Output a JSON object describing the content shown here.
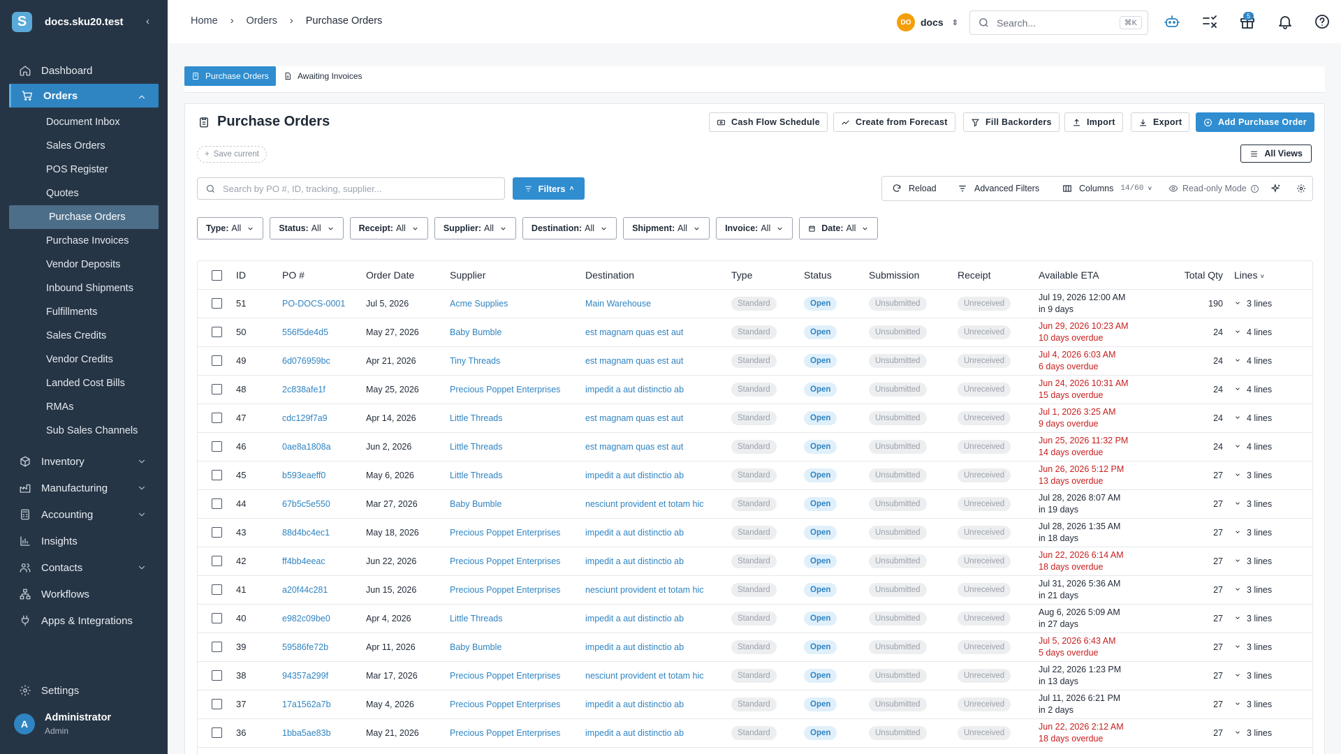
{
  "app": {
    "domain": "docs.sku20.test",
    "logo_letter": "S"
  },
  "sidebar": {
    "items": [
      {
        "label": "Dashboard",
        "icon": "home-icon"
      },
      {
        "label": "Orders",
        "icon": "cart-icon",
        "expanded": true
      },
      {
        "label": "Inventory",
        "icon": "box-icon"
      },
      {
        "label": "Manufacturing",
        "icon": "factory-icon"
      },
      {
        "label": "Accounting",
        "icon": "calculator-icon"
      },
      {
        "label": "Insights",
        "icon": "chart-icon"
      },
      {
        "label": "Contacts",
        "icon": "contacts-icon"
      },
      {
        "label": "Workflows",
        "icon": "workflow-icon"
      },
      {
        "label": "Apps & Integrations",
        "icon": "plug-icon"
      }
    ],
    "orders_sub": [
      "Document Inbox",
      "Sales Orders",
      "POS Register",
      "Quotes",
      "Purchase Orders",
      "Purchase Invoices",
      "Vendor Deposits",
      "Inbound Shipments",
      "Fulfillments",
      "Sales Credits",
      "Vendor Credits",
      "Landed Cost Bills",
      "RMAs",
      "Sub Sales Channels"
    ],
    "settings": "Settings",
    "user": {
      "initial": "A",
      "name": "Administrator",
      "role": "Admin"
    }
  },
  "topbar": {
    "breadcrumb": [
      "Home",
      "Orders",
      "Purchase Orders"
    ],
    "workspace": {
      "initials": "DO",
      "name": "docs"
    },
    "search": {
      "placeholder": "Search...",
      "shortcut": "⌘K"
    },
    "notification_badge": "5"
  },
  "tabs": [
    "Purchase Orders",
    "Awaiting Invoices"
  ],
  "page": {
    "title": "Purchase Orders",
    "actions": [
      "Cash Flow Schedule",
      "Create from Forecast",
      "Fill Backorders",
      "Import",
      "Export",
      "Add Purchase Order"
    ],
    "save_current": "Save current",
    "all_views": "All Views",
    "search_placeholder": "Search by PO #, ID, tracking, supplier...",
    "filters_label": "Filters",
    "toolbar": {
      "reload": "Reload",
      "advanced": "Advanced Filters",
      "columns": "Columns",
      "columns_count": "14/60",
      "readonly": "Read-only Mode"
    },
    "filter_chips": [
      {
        "key": "Type:",
        "value": "All"
      },
      {
        "key": "Status:",
        "value": "All"
      },
      {
        "key": "Receipt:",
        "value": "All"
      },
      {
        "key": "Supplier:",
        "value": "All"
      },
      {
        "key": "Destination:",
        "value": "All"
      },
      {
        "key": "Shipment:",
        "value": "All"
      },
      {
        "key": "Invoice:",
        "value": "All"
      },
      {
        "key": "Date:",
        "value": "All"
      }
    ]
  },
  "table": {
    "columns": [
      "ID",
      "PO #",
      "Order Date",
      "Supplier",
      "Destination",
      "Type",
      "Status",
      "Submission",
      "Receipt",
      "Available ETA",
      "Total Qty",
      "Lines"
    ],
    "rows": [
      {
        "id": "51",
        "po": "PO-DOCS-0001",
        "date": "Jul 5, 2026",
        "supplier": "Acme Supplies",
        "dest": "Main Warehouse",
        "type": "Standard",
        "status": "Open",
        "sub": "Unsubmitted",
        "receipt": "Unreceived",
        "eta": "Jul 19, 2026 12:00 AM",
        "eta_note": "in 9 days",
        "overdue": false,
        "qty": "190",
        "lines": "3 lines"
      },
      {
        "id": "50",
        "po": "556f5de4d5",
        "date": "May 27, 2026",
        "supplier": "Baby Bumble",
        "dest": "est magnam quas est aut",
        "type": "Standard",
        "status": "Open",
        "sub": "Unsubmitted",
        "receipt": "Unreceived",
        "eta": "Jun 29, 2026 10:23 AM",
        "eta_note": "10 days overdue",
        "overdue": true,
        "qty": "24",
        "lines": "4 lines"
      },
      {
        "id": "49",
        "po": "6d076959bc",
        "date": "Apr 21, 2026",
        "supplier": "Tiny Threads",
        "dest": "est magnam quas est aut",
        "type": "Standard",
        "status": "Open",
        "sub": "Unsubmitted",
        "receipt": "Unreceived",
        "eta": "Jul 4, 2026 6:03 AM",
        "eta_note": "6 days overdue",
        "overdue": true,
        "qty": "24",
        "lines": "4 lines"
      },
      {
        "id": "48",
        "po": "2c838afe1f",
        "date": "May 25, 2026",
        "supplier": "Precious Poppet Enterprises",
        "dest": "impedit a aut distinctio ab",
        "type": "Standard",
        "status": "Open",
        "sub": "Unsubmitted",
        "receipt": "Unreceived",
        "eta": "Jun 24, 2026 10:31 AM",
        "eta_note": "15 days overdue",
        "overdue": true,
        "qty": "24",
        "lines": "4 lines"
      },
      {
        "id": "47",
        "po": "cdc129f7a9",
        "date": "Apr 14, 2026",
        "supplier": "Little Threads",
        "dest": "est magnam quas est aut",
        "type": "Standard",
        "status": "Open",
        "sub": "Unsubmitted",
        "receipt": "Unreceived",
        "eta": "Jul 1, 2026 3:25 AM",
        "eta_note": "9 days overdue",
        "overdue": true,
        "qty": "24",
        "lines": "4 lines"
      },
      {
        "id": "46",
        "po": "0ae8a1808a",
        "date": "Jun 2, 2026",
        "supplier": "Little Threads",
        "dest": "est magnam quas est aut",
        "type": "Standard",
        "status": "Open",
        "sub": "Unsubmitted",
        "receipt": "Unreceived",
        "eta": "Jun 25, 2026 11:32 PM",
        "eta_note": "14 days overdue",
        "overdue": true,
        "qty": "24",
        "lines": "4 lines"
      },
      {
        "id": "45",
        "po": "b593eaeff0",
        "date": "May 6, 2026",
        "supplier": "Little Threads",
        "dest": "impedit a aut distinctio ab",
        "type": "Standard",
        "status": "Open",
        "sub": "Unsubmitted",
        "receipt": "Unreceived",
        "eta": "Jun 26, 2026 5:12 PM",
        "eta_note": "13 days overdue",
        "overdue": true,
        "qty": "27",
        "lines": "3 lines"
      },
      {
        "id": "44",
        "po": "67b5c5e550",
        "date": "Mar 27, 2026",
        "supplier": "Baby Bumble",
        "dest": "nesciunt provident et totam hic",
        "type": "Standard",
        "status": "Open",
        "sub": "Unsubmitted",
        "receipt": "Unreceived",
        "eta": "Jul 28, 2026 8:07 AM",
        "eta_note": "in 19 days",
        "overdue": false,
        "qty": "27",
        "lines": "3 lines"
      },
      {
        "id": "43",
        "po": "88d4bc4ec1",
        "date": "May 18, 2026",
        "supplier": "Precious Poppet Enterprises",
        "dest": "impedit a aut distinctio ab",
        "type": "Standard",
        "status": "Open",
        "sub": "Unsubmitted",
        "receipt": "Unreceived",
        "eta": "Jul 28, 2026 1:35 AM",
        "eta_note": "in 18 days",
        "overdue": false,
        "qty": "27",
        "lines": "3 lines"
      },
      {
        "id": "42",
        "po": "ff4bb4eeac",
        "date": "Jun 22, 2026",
        "supplier": "Precious Poppet Enterprises",
        "dest": "impedit a aut distinctio ab",
        "type": "Standard",
        "status": "Open",
        "sub": "Unsubmitted",
        "receipt": "Unreceived",
        "eta": "Jun 22, 2026 6:14 AM",
        "eta_note": "18 days overdue",
        "overdue": true,
        "qty": "27",
        "lines": "3 lines"
      },
      {
        "id": "41",
        "po": "a20f44c281",
        "date": "Jun 15, 2026",
        "supplier": "Precious Poppet Enterprises",
        "dest": "nesciunt provident et totam hic",
        "type": "Standard",
        "status": "Open",
        "sub": "Unsubmitted",
        "receipt": "Unreceived",
        "eta": "Jul 31, 2026 5:36 AM",
        "eta_note": "in 21 days",
        "overdue": false,
        "qty": "27",
        "lines": "3 lines"
      },
      {
        "id": "40",
        "po": "e982c09be0",
        "date": "Apr 4, 2026",
        "supplier": "Little Threads",
        "dest": "impedit a aut distinctio ab",
        "type": "Standard",
        "status": "Open",
        "sub": "Unsubmitted",
        "receipt": "Unreceived",
        "eta": "Aug 6, 2026 5:09 AM",
        "eta_note": "in 27 days",
        "overdue": false,
        "qty": "27",
        "lines": "3 lines"
      },
      {
        "id": "39",
        "po": "59586fe72b",
        "date": "Apr 11, 2026",
        "supplier": "Baby Bumble",
        "dest": "impedit a aut distinctio ab",
        "type": "Standard",
        "status": "Open",
        "sub": "Unsubmitted",
        "receipt": "Unreceived",
        "eta": "Jul 5, 2026 6:43 AM",
        "eta_note": "5 days overdue",
        "overdue": true,
        "qty": "27",
        "lines": "3 lines"
      },
      {
        "id": "38",
        "po": "94357a299f",
        "date": "Mar 17, 2026",
        "supplier": "Precious Poppet Enterprises",
        "dest": "nesciunt provident et totam hic",
        "type": "Standard",
        "status": "Open",
        "sub": "Unsubmitted",
        "receipt": "Unreceived",
        "eta": "Jul 22, 2026 1:23 PM",
        "eta_note": "in 13 days",
        "overdue": false,
        "qty": "27",
        "lines": "3 lines"
      },
      {
        "id": "37",
        "po": "17a1562a7b",
        "date": "May 4, 2026",
        "supplier": "Precious Poppet Enterprises",
        "dest": "impedit a aut distinctio ab",
        "type": "Standard",
        "status": "Open",
        "sub": "Unsubmitted",
        "receipt": "Unreceived",
        "eta": "Jul 11, 2026 6:21 PM",
        "eta_note": "in 2 days",
        "overdue": false,
        "qty": "27",
        "lines": "3 lines"
      },
      {
        "id": "36",
        "po": "1bba5ae83b",
        "date": "May 21, 2026",
        "supplier": "Precious Poppet Enterprises",
        "dest": "impedit a aut distinctio ab",
        "type": "Standard",
        "status": "Open",
        "sub": "Unsubmitted",
        "receipt": "Unreceived",
        "eta": "Jun 22, 2026 2:12 AM",
        "eta_note": "18 days overdue",
        "overdue": true,
        "qty": "27",
        "lines": "3 lines"
      }
    ]
  },
  "colors": {
    "sidebar": "#263545",
    "accent": "#2f8dd0",
    "overdue": "#c81e1e",
    "link": "#2f84c2"
  }
}
